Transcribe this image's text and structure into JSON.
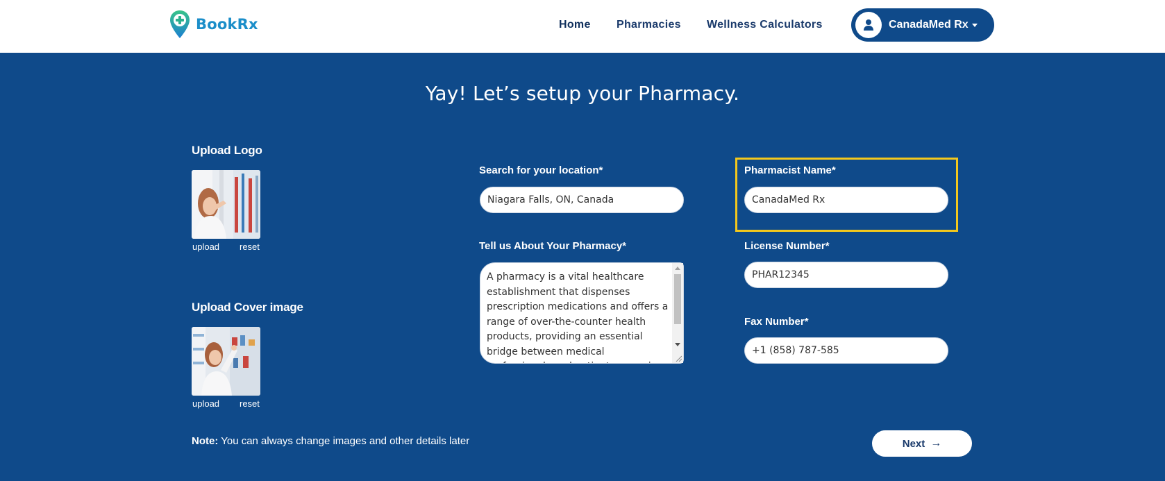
{
  "brand": {
    "name": "BookRx",
    "logo_icon": "location-pin-plus-icon",
    "color": "#1b8ec9"
  },
  "nav": {
    "items": [
      {
        "label": "Home",
        "active": true
      },
      {
        "label": "Pharmacies",
        "active": false
      },
      {
        "label": "Wellness Calculators",
        "active": false
      }
    ]
  },
  "user_menu": {
    "name": "CanadaMed Rx",
    "icon": "user-icon",
    "caret_icon": "caret-down-icon"
  },
  "page": {
    "title": "Yay! Let’s setup your Pharmacy."
  },
  "uploads": {
    "logo": {
      "title": "Upload Logo",
      "upload_label": "upload",
      "reset_label": "reset"
    },
    "cover": {
      "title": "Upload Cover image",
      "upload_label": "upload",
      "reset_label": "reset"
    }
  },
  "form": {
    "location": {
      "label": "Search for your location*",
      "value": "Niagara Falls, ON, Canada"
    },
    "about": {
      "label": "Tell us About Your Pharmacy*",
      "value": "A pharmacy is a vital healthcare establishment that dispenses prescription medications and offers a range of over-the-counter health products, providing an essential bridge between medical professionals and patients, ensuring their well-being and"
    },
    "pharmacist_name": {
      "label": "Pharmacist Name*",
      "value": "CanadaMed Rx"
    },
    "license_number": {
      "label": "License Number*",
      "value": "PHAR12345"
    },
    "fax_number": {
      "label": "Fax Number*",
      "value": "+1 (858) 787-585"
    }
  },
  "note": {
    "prefix": "Note:",
    "text": " You can always change images and other details later"
  },
  "next_button": {
    "label": "Next",
    "icon": "arrow-right-icon"
  },
  "colors": {
    "background": "#0f4a8a",
    "highlight": "#f4c81c",
    "header": "#ffffff"
  }
}
